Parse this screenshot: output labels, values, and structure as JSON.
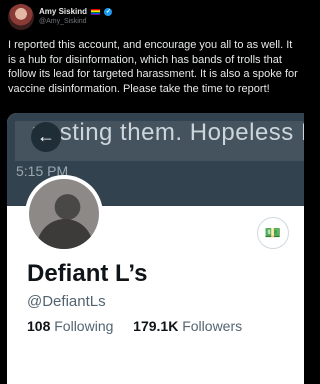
{
  "tweet": {
    "author_name": "Amy Siskind",
    "author_handle": "@Amy_Siskind",
    "text": "I reported this account, and encourage you all to as well. It is a hub for disinformation, which has bands of trolls that follow its lead for targeted harassment. It is also a spoke for vaccine disinformation. Please take the time to report!"
  },
  "embed": {
    "banner_text": "posting them. Hopeless PO",
    "time": "5:15 PM",
    "back_icon": "arrow-left-icon",
    "tip_icon": "money-icon",
    "profile": {
      "name": "Defiant L’s",
      "handle": "@DefiantLs",
      "following_count": "108",
      "following_label": "Following",
      "followers_count": "179.1K",
      "followers_label": "Followers"
    }
  },
  "colors": {
    "verified": "#1d9bf0",
    "banner": "#32434f"
  }
}
